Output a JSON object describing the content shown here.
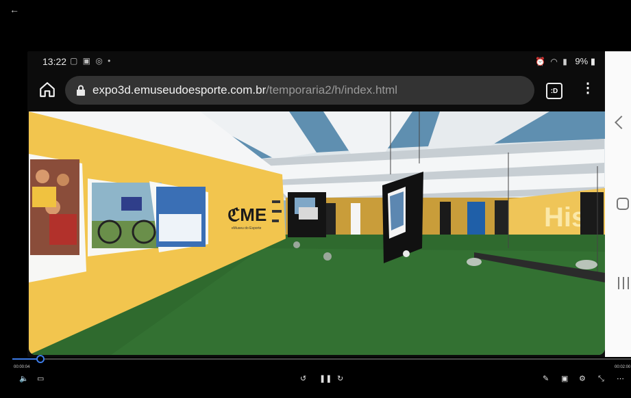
{
  "video_player": {
    "current_time": "00:00:04",
    "total_time": "00:02:00",
    "progress_fraction": 0.045
  },
  "phone": {
    "status_bar": {
      "time": "13:22",
      "battery": "9%"
    },
    "browser": {
      "url_domain": "expo3d.emuseudoesporte.com.br",
      "url_path": "/temporaria2/h/index.html",
      "tab_count": ":D"
    }
  },
  "exhibit_scene": {
    "logo_text": "ℭME",
    "logo_subtext": "eMuseu do Esporte",
    "wall_text": "His"
  },
  "colors": {
    "accent": "#3d7ce8",
    "wall_yellow": "#f2c54e",
    "floor_green": "#2f6a2e",
    "ceiling": "#e9ecef"
  }
}
